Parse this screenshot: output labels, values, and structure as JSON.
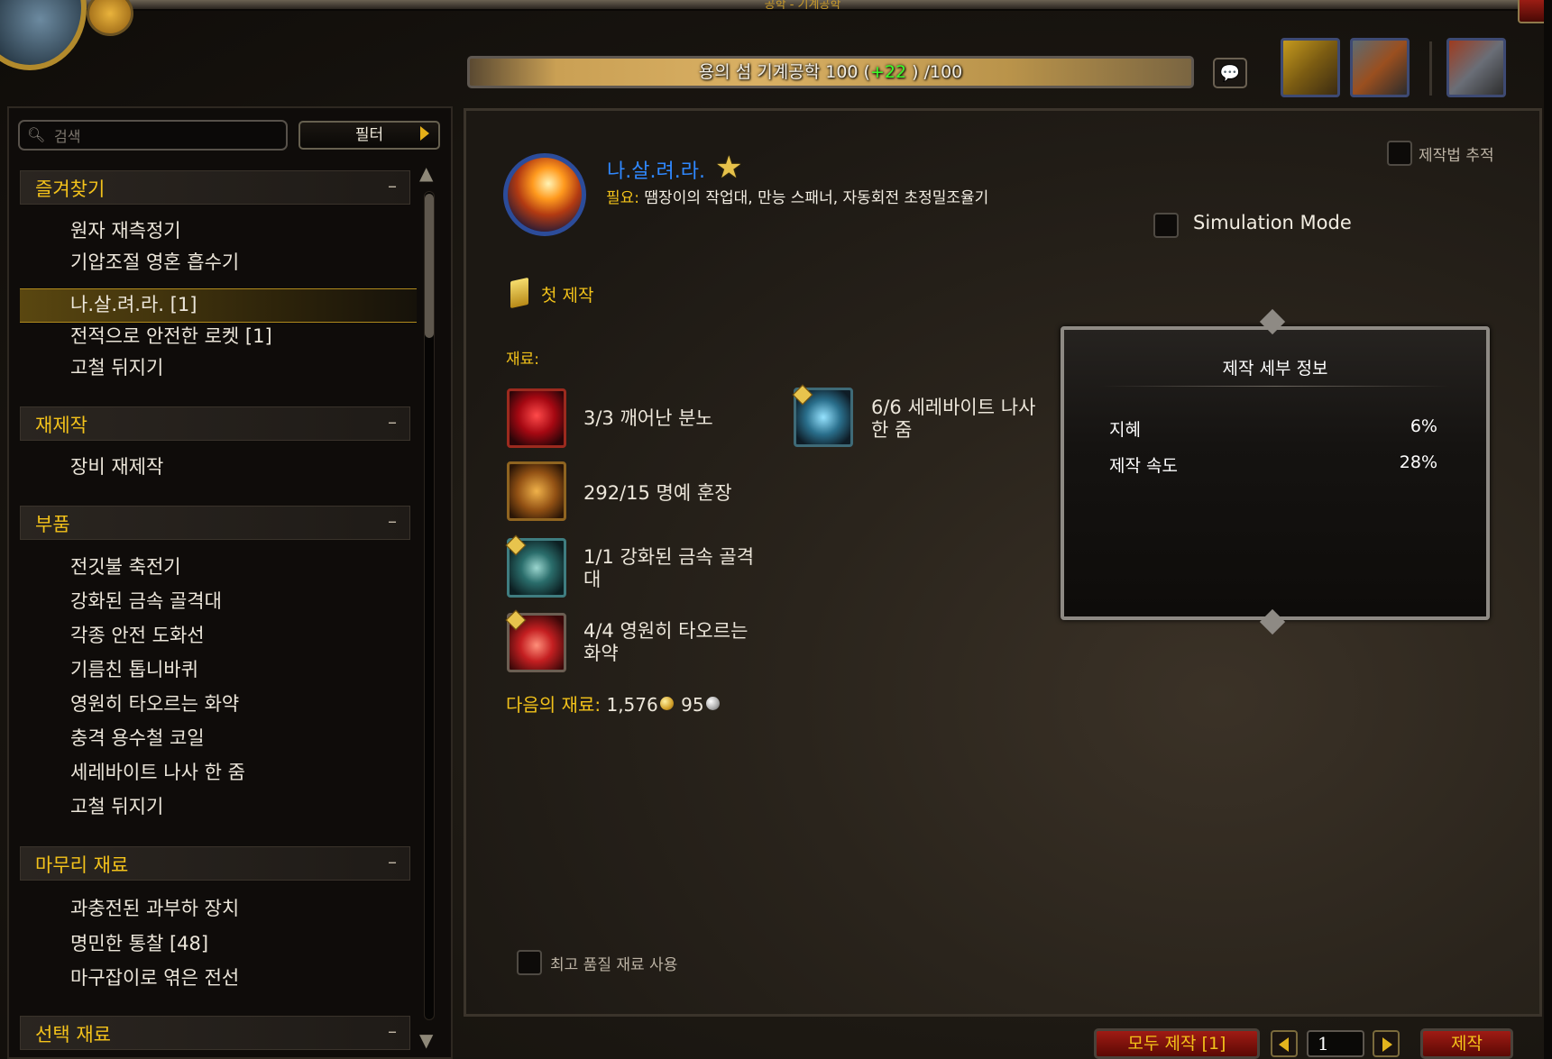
{
  "window": {
    "title": "공학 - 기계공학"
  },
  "skill": {
    "name": "용의 섬 기계공학",
    "current": "100",
    "bonus": "+22",
    "max": "/100",
    "prefix": "(",
    "suffix": ")"
  },
  "search": {
    "placeholder": "검색",
    "filter_label": "필터"
  },
  "categories": [
    {
      "label": "즐겨찾기",
      "collapse": "–",
      "items": [
        "원자 재측정기",
        "기압조절 영혼 흡수기",
        "나.살.려.라. [1]",
        "전적으로 안전한 로켓 [1]",
        "고철 뒤지기"
      ]
    },
    {
      "label": "재제작",
      "collapse": "–",
      "items": [
        "장비 재제작"
      ]
    },
    {
      "label": "부품",
      "collapse": "–",
      "items": [
        "전깃불 축전기",
        "강화된 금속 골격대",
        "각종 안전 도화선",
        "기름친 톱니바퀴",
        "영원히 타오르는 화약",
        "충격 용수철 코일",
        "세레바이트 나사 한 줌",
        "고철 뒤지기"
      ]
    },
    {
      "label": "마무리 재료",
      "collapse": "–",
      "items": [
        "과충전된 과부하 장치",
        "명민한 통찰 [48]",
        "마구잡이로 엮은 전선"
      ]
    },
    {
      "label": "선택 재료",
      "collapse": "–",
      "items": []
    }
  ],
  "recipe": {
    "name": "나.살.려.라.",
    "required_label": "필요:",
    "required": " 땜장이의 작업대, 만능 스패너, 자동회전 초정밀조율기",
    "first_craft": "첫 제작",
    "reagents_label": "재료:",
    "reagents": [
      {
        "text": "3/3 깨어난 분노",
        "icon": "awakened-fury-icon",
        "quality": false
      },
      {
        "text": "292/15 명예 훈장",
        "icon": "mark-of-honor-icon",
        "quality": false
      },
      {
        "text": "1/1 강화된 금속 골격대",
        "icon": "reinforced-machine-chassis-icon",
        "quality": true
      },
      {
        "text": "4/4 영원히 타오르는 화약",
        "icon": "everburning-blasting-powder-icon",
        "quality": true
      },
      {
        "text": "6/6 세레바이트 나사 한 줌",
        "icon": "handful-of-serevite-bolts-icon",
        "quality": true
      }
    ],
    "next_reagents_label": "다음의 재료:",
    "gold": "1,576",
    "silver": "95"
  },
  "track_label": "제작법 추적",
  "simulation_label": "Simulation Mode",
  "details": {
    "title": "제작 세부 정보",
    "stats": [
      {
        "name": "지혜",
        "value": "6%"
      },
      {
        "name": "제작 속도",
        "value": "28%"
      }
    ]
  },
  "best_quality_label": "최고 품질 재료 사용",
  "buttons": {
    "craft_all": "모두 제작 [1]",
    "quantity": "1",
    "craft": "제작"
  },
  "colors": {
    "accent": "#f2c21a",
    "recipe_name": "#2f88ff",
    "bonus": "#3cff2a",
    "button": "#a01b14"
  }
}
